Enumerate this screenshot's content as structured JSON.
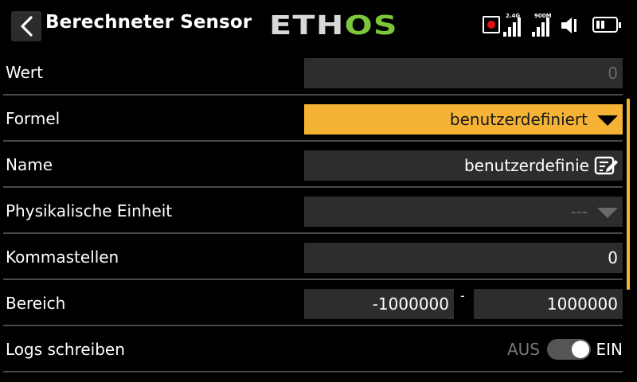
{
  "header": {
    "title": "Berechneter Sensor",
    "logo_left": "ETH",
    "logo_right": "OS",
    "signal1_label": "2.4G",
    "signal2_label": "900M"
  },
  "rows": [
    {
      "label": "Wert",
      "value": "0"
    },
    {
      "label": "Formel",
      "value": "benutzerdefiniert"
    },
    {
      "label": "Name",
      "value": "benutzerdefinie"
    },
    {
      "label": "Physikalische Einheit",
      "value": "---"
    },
    {
      "label": "Kommastellen",
      "value": "0"
    },
    {
      "label": "Bereich",
      "min": "-1000000",
      "separator": "-",
      "max": "1000000"
    },
    {
      "label": "Logs schreiben",
      "off_label": "AUS",
      "on_label": "EIN",
      "state": "on"
    }
  ],
  "colors": {
    "accent": "#f5b335",
    "logo_green": "#7cc639",
    "field_bg": "#2d2d2d",
    "record_red": "#e01010"
  },
  "icons": {
    "back": "chevron-left-icon",
    "record": "record-icon",
    "signal": "signal-bars-icon",
    "speaker": "speaker-icon",
    "battery": "battery-icon",
    "edit": "edit-icon",
    "dropdown": "triangle-down-icon"
  }
}
